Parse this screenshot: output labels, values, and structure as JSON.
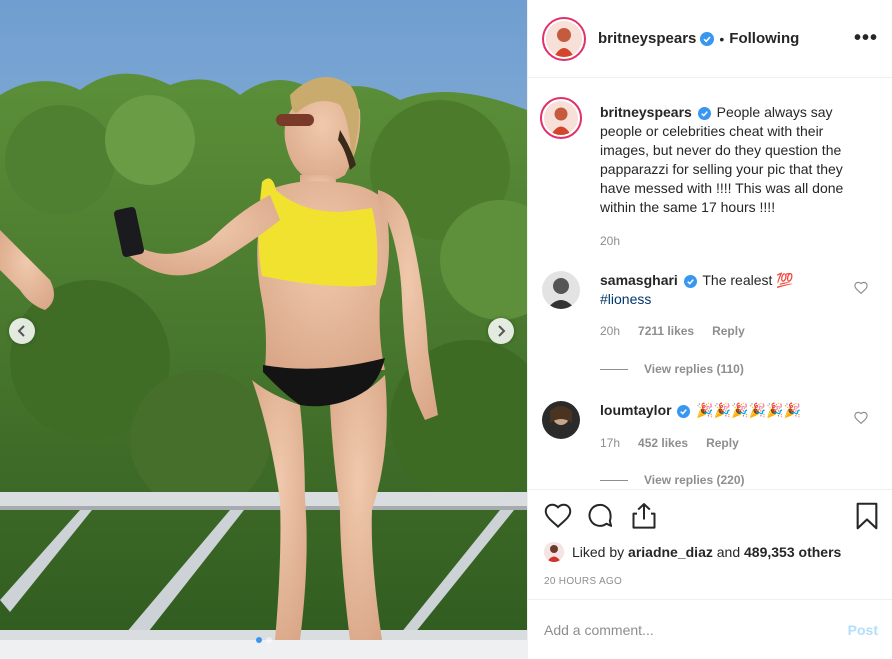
{
  "header": {
    "username": "britneyspears",
    "separator": "•",
    "follow_status": "Following",
    "more_label": "•••"
  },
  "caption": {
    "username": "britneyspears",
    "text": "People always say people or celebrities cheat with their images, but never do they question the papparazzi for selling your pic that they have messed with !!!! This was all done within the same 17 hours !!!!",
    "time": "20h"
  },
  "comments": [
    {
      "username": "samasghari",
      "text": "The realest 💯",
      "hashtag": "#lioness",
      "time": "20h",
      "likes": "7211 likes",
      "reply_label": "Reply",
      "view_replies": "View replies (110)"
    },
    {
      "username": "loumtaylor",
      "text": "🎉🎉🎉🎉🎉🎉",
      "time": "17h",
      "likes": "452 likes",
      "reply_label": "Reply",
      "view_replies": "View replies (220)"
    }
  ],
  "likes": {
    "prefix": "Liked by",
    "user": "ariadne_diaz",
    "middle": "and",
    "count": "489,353 others"
  },
  "timestamp": "20 HOURS AGO",
  "add_comment": {
    "placeholder": "Add a comment...",
    "post_label": "Post"
  },
  "carousel": {
    "total": 2,
    "active_index": 0
  },
  "icons": [
    "heart-icon",
    "comment-icon",
    "share-icon",
    "bookmark-icon",
    "verified-icon",
    "chevron-left-icon",
    "chevron-right-icon"
  ],
  "colors": {
    "verified": "#3897f0",
    "post_button": "#b2dffc",
    "meta_text": "#8e8e8e"
  }
}
